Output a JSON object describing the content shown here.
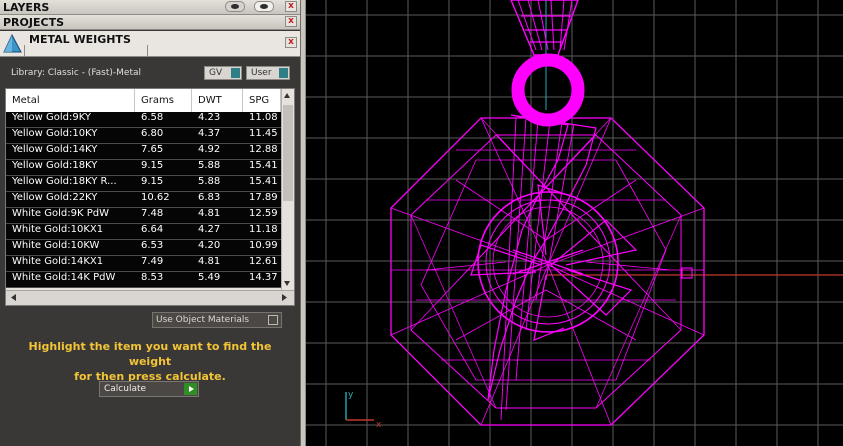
{
  "panels": {
    "layers": "LAYERS",
    "projects": "PROJECTS",
    "metal_weights": "METAL WEIGHTS",
    "close_glyph": "x"
  },
  "library": {
    "label": "Library: Classic - (Fast)-Metal",
    "gv": "GV",
    "user": "User"
  },
  "table": {
    "headers": [
      "Metal",
      "Grams",
      "DWT",
      "SPG"
    ],
    "rows": [
      [
        "Yellow Gold:9KY",
        "6.58",
        "4.23",
        "11.08"
      ],
      [
        "Yellow Gold:10KY",
        "6.80",
        "4.37",
        "11.45"
      ],
      [
        "Yellow Gold:14KY",
        "7.65",
        "4.92",
        "12.88"
      ],
      [
        "Yellow Gold:18KY",
        "9.15",
        "5.88",
        "15.41"
      ],
      [
        "Yellow Gold:18KY R...",
        "9.15",
        "5.88",
        "15.41"
      ],
      [
        "Yellow Gold:22KY",
        "10.62",
        "6.83",
        "17.89"
      ],
      [
        "White Gold:9K PdW",
        "7.48",
        "4.81",
        "12.59"
      ],
      [
        "White Gold:10KX1",
        "6.64",
        "4.27",
        "11.18"
      ],
      [
        "White Gold:10KW",
        "6.53",
        "4.20",
        "10.99"
      ],
      [
        "White Gold:14KX1",
        "7.49",
        "4.81",
        "12.61"
      ],
      [
        "White Gold:14K PdW",
        "8.53",
        "5.49",
        "14.37"
      ]
    ]
  },
  "use_object_materials": "Use Object Materials",
  "help_text": {
    "line1": "Highlight the item you want to find the weight",
    "line2": "for then press calculate."
  },
  "calculate": "Calculate",
  "viewport": {
    "axis_y": "y",
    "axis_x": "x",
    "colors": {
      "wireframe": "#ff00ff",
      "grid": "#5b5b5b",
      "x_axis": "#c0392b",
      "y_axis": "#2aa9b6"
    }
  }
}
